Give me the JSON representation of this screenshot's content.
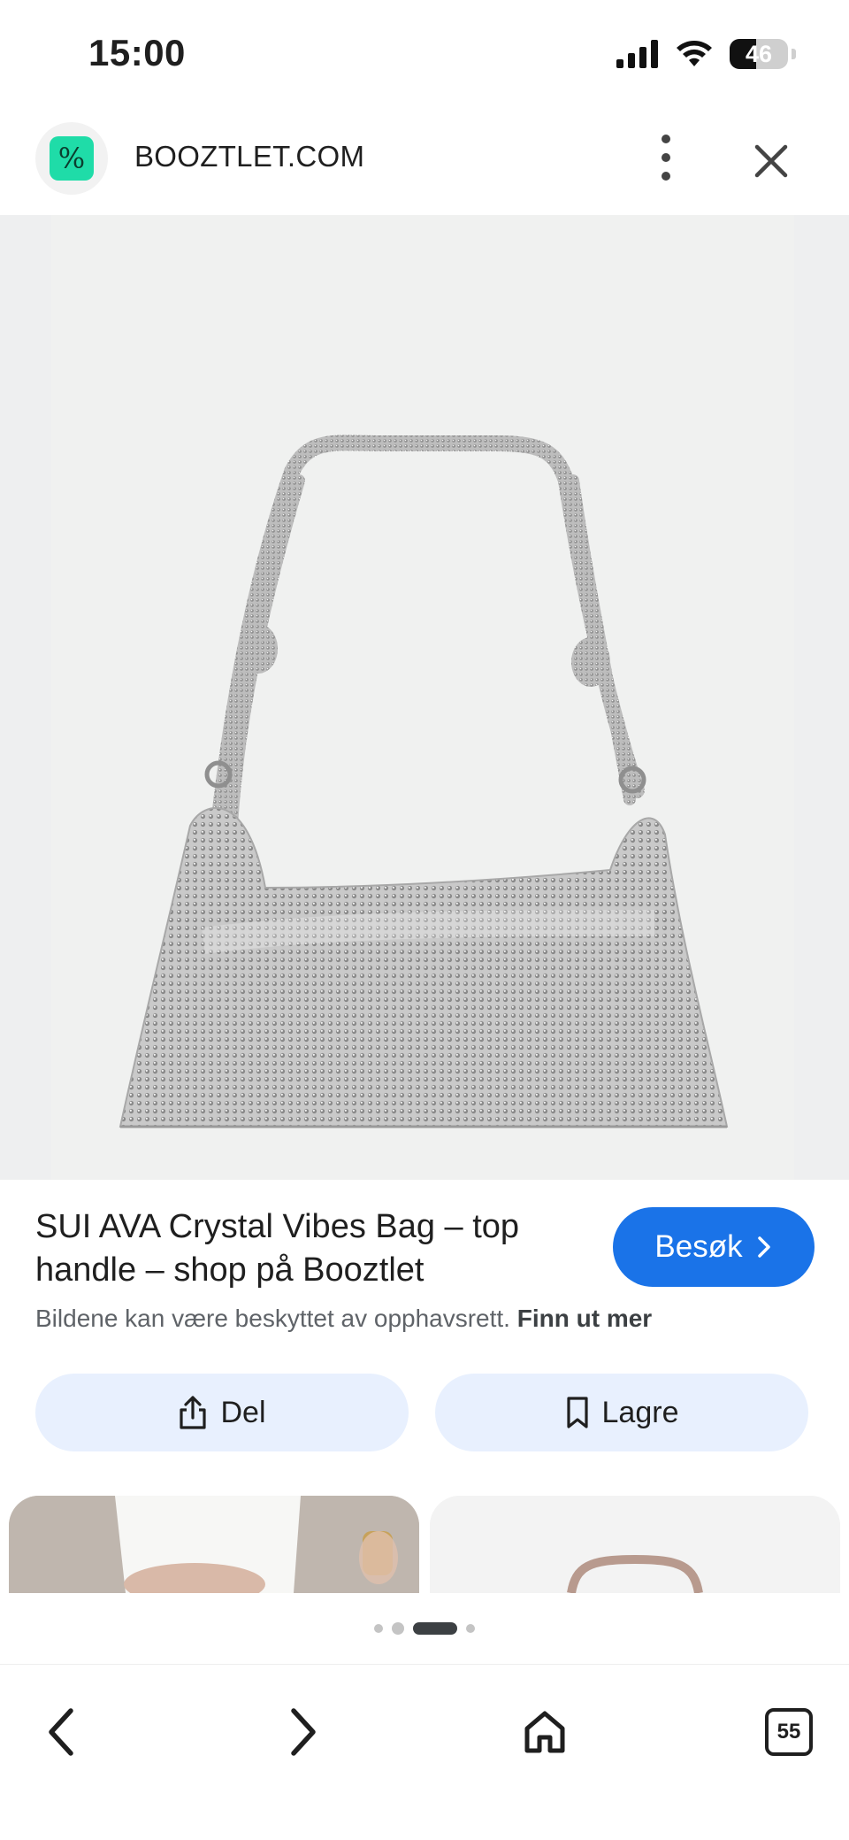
{
  "status_bar": {
    "time": "15:00",
    "battery": "46"
  },
  "header": {
    "site_name": "BOOZTLET.COM",
    "logo_glyph": "%"
  },
  "product": {
    "title": "SUI AVA Crystal Vibes Bag – top handle – shop på Booztlet",
    "visit_label": "Besøk",
    "copyright_text": "Bildene kan være beskyttet av opphavsrett.",
    "learn_more": "Finn ut mer"
  },
  "actions": {
    "share_label": "Del",
    "save_label": "Lagre"
  },
  "bottom_nav": {
    "tab_count": "55"
  },
  "colors": {
    "accent": "#1a73e8",
    "action_bg": "#e8f0fe",
    "logo_green": "#1fdca8"
  }
}
